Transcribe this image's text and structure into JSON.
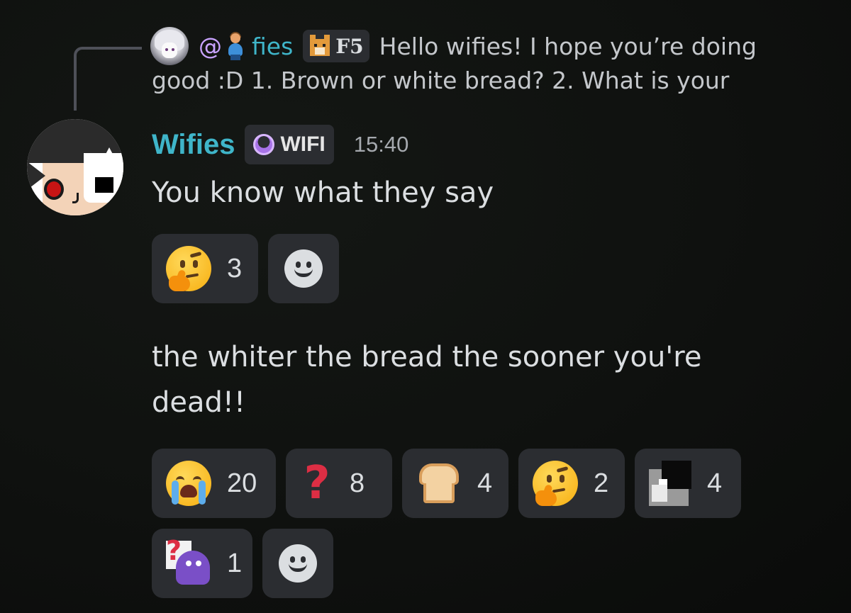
{
  "reply": {
    "mention": "@",
    "name": "fies",
    "tag_label": "F5",
    "message_line1": "Hello wifies! I hope you’re doing",
    "message_line2": "good :D 1.  Brown or white bread?    2.  What is your"
  },
  "message": {
    "author": "Wifies",
    "tag_label": "WIFI",
    "timestamp": "15:40",
    "text1": "You know what they say",
    "text2": "the whiter the bread the sooner you're dead!!"
  },
  "reactions_group1": [
    {
      "emoji": "thinking-face",
      "count": "3"
    }
  ],
  "reactions_group2": [
    {
      "emoji": "loudly-crying-face",
      "count": "20"
    },
    {
      "emoji": "red-question-mark",
      "count": "8"
    },
    {
      "emoji": "bread",
      "count": "4"
    },
    {
      "emoji": "thinking-face",
      "count": "2"
    },
    {
      "emoji": "custom-meme-sticker",
      "count": "4"
    },
    {
      "emoji": "custom-grimace-question",
      "count": "1"
    }
  ],
  "colors": {
    "background": "#0f110f",
    "author": "#3fb5c9",
    "mention": "#c9a3ff",
    "pill": "#2b2d31",
    "text": "#dbdee1"
  }
}
